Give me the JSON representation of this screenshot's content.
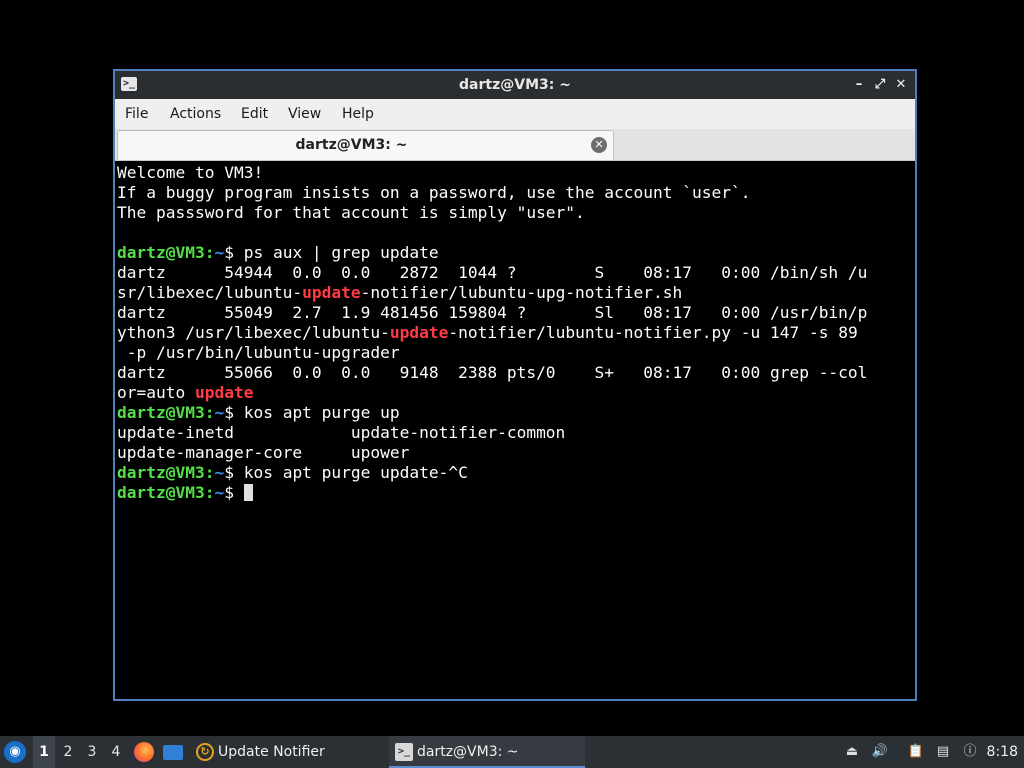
{
  "window": {
    "title": "dartz@VM3: ~",
    "minimize": "–",
    "maximize": "⤢",
    "close": "✕",
    "icon": "terminal-icon"
  },
  "menubar": {
    "items": [
      "File",
      "Actions",
      "Edit",
      "View",
      "Help"
    ]
  },
  "tab": {
    "label": "dartz@VM3: ~",
    "close": "✕"
  },
  "terminal": {
    "colors": {
      "user": "#54e048",
      "path": "#3a8fe8",
      "highlight": "#ff3b46",
      "text": "#ffffff",
      "background": "#000000"
    },
    "lines": [
      [
        {
          "t": "Welcome to VM3!"
        }
      ],
      [
        {
          "t": "If a buggy program insists on a password, use the account `user`."
        }
      ],
      [
        {
          "t": "The passsword for that account is simply \"user\"."
        }
      ],
      [
        {
          "t": ""
        }
      ],
      [
        {
          "t": "dartz@VM3",
          "c": "user"
        },
        {
          "t": ":",
          "c": "user"
        },
        {
          "t": "~",
          "c": "path"
        },
        {
          "t": "$ ps aux | grep update"
        }
      ],
      [
        {
          "t": "dartz      54944  0.0  0.0   2872  1044 ?        S    08:17   0:00 /bin/sh /u"
        }
      ],
      [
        {
          "t": "sr/libexec/lubuntu-"
        },
        {
          "t": "update",
          "c": "hl"
        },
        {
          "t": "-notifier/lubuntu-upg-notifier.sh"
        }
      ],
      [
        {
          "t": "dartz      55049  2.7  1.9 481456 159804 ?       Sl   08:17   0:00 /usr/bin/p"
        }
      ],
      [
        {
          "t": "ython3 /usr/libexec/lubuntu-"
        },
        {
          "t": "update",
          "c": "hl"
        },
        {
          "t": "-notifier/lubuntu-notifier.py -u 147 -s 89"
        }
      ],
      [
        {
          "t": " -p /usr/bin/lubuntu-upgrader"
        }
      ],
      [
        {
          "t": "dartz      55066  0.0  0.0   9148  2388 pts/0    S+   08:17   0:00 grep --col"
        }
      ],
      [
        {
          "t": "or=auto "
        },
        {
          "t": "update",
          "c": "hl"
        }
      ],
      [
        {
          "t": "dartz@VM3",
          "c": "user"
        },
        {
          "t": ":",
          "c": "user"
        },
        {
          "t": "~",
          "c": "path"
        },
        {
          "t": "$ kos apt purge up"
        }
      ],
      [
        {
          "t": "update-inetd            update-notifier-common"
        }
      ],
      [
        {
          "t": "update-manager-core     upower"
        }
      ],
      [
        {
          "t": "dartz@VM3",
          "c": "user"
        },
        {
          "t": ":",
          "c": "user"
        },
        {
          "t": "~",
          "c": "path"
        },
        {
          "t": "$ kos apt purge update-^C"
        }
      ],
      [
        {
          "t": "dartz@VM3",
          "c": "user"
        },
        {
          "t": ":",
          "c": "user"
        },
        {
          "t": "~",
          "c": "path"
        },
        {
          "t": "$ "
        },
        {
          "cursor": true
        }
      ]
    ]
  },
  "taskbar": {
    "start_icon": "lubuntu-start-icon",
    "workspaces": [
      "1",
      "2",
      "3",
      "4"
    ],
    "active_workspace": "1",
    "quicklaunch": [
      "firefox-icon",
      "file-manager-icon"
    ],
    "tasks": [
      {
        "label": "Update Notifier",
        "icon": "update-notifier-icon",
        "active": false
      },
      {
        "label": "dartz@VM3: ~",
        "icon": "terminal-icon",
        "active": true
      }
    ],
    "tray": [
      "eject-icon",
      "volume-icon",
      "clipboard-icon",
      "network-icon",
      "notification-icon"
    ],
    "clock": "8:18"
  }
}
